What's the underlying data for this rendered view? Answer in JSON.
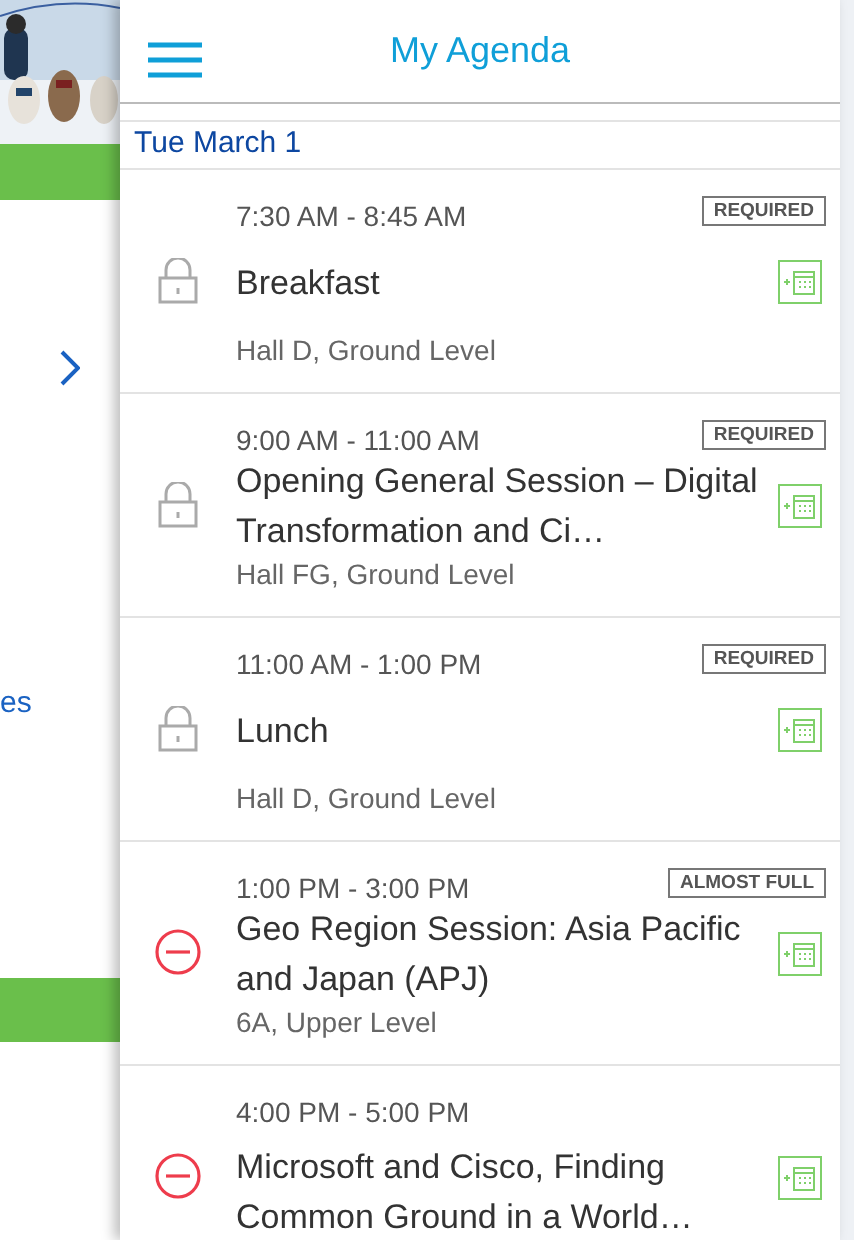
{
  "background_page": {
    "link_fragment": "es"
  },
  "header": {
    "title": "My Agenda"
  },
  "date": "Tue March 1",
  "sessions": [
    {
      "kind": "locked",
      "time": "7:30 AM - 8:45 AM",
      "tag": "REQUIRED",
      "title": "Breakfast",
      "location": "Hall D, Ground Level"
    },
    {
      "kind": "locked",
      "time": "9:00 AM - 11:00 AM",
      "tag": "REQUIRED",
      "title": "Opening General Session – Digital Transformation and Ci…",
      "location": "Hall FG, Ground Level"
    },
    {
      "kind": "locked",
      "time": "11:00 AM - 1:00 PM",
      "tag": "REQUIRED",
      "title": "Lunch",
      "location": "Hall D, Ground Level"
    },
    {
      "kind": "removable",
      "time": "1:00 PM - 3:00 PM",
      "tag": "ALMOST FULL",
      "title": "Geo Region Session: Asia Pacific and Japan (APJ)",
      "location": "6A, Upper Level"
    },
    {
      "kind": "removable",
      "time": "4:00 PM - 5:00 PM",
      "title": "Microsoft and Cisco, Finding Common Ground in a World…"
    }
  ]
}
